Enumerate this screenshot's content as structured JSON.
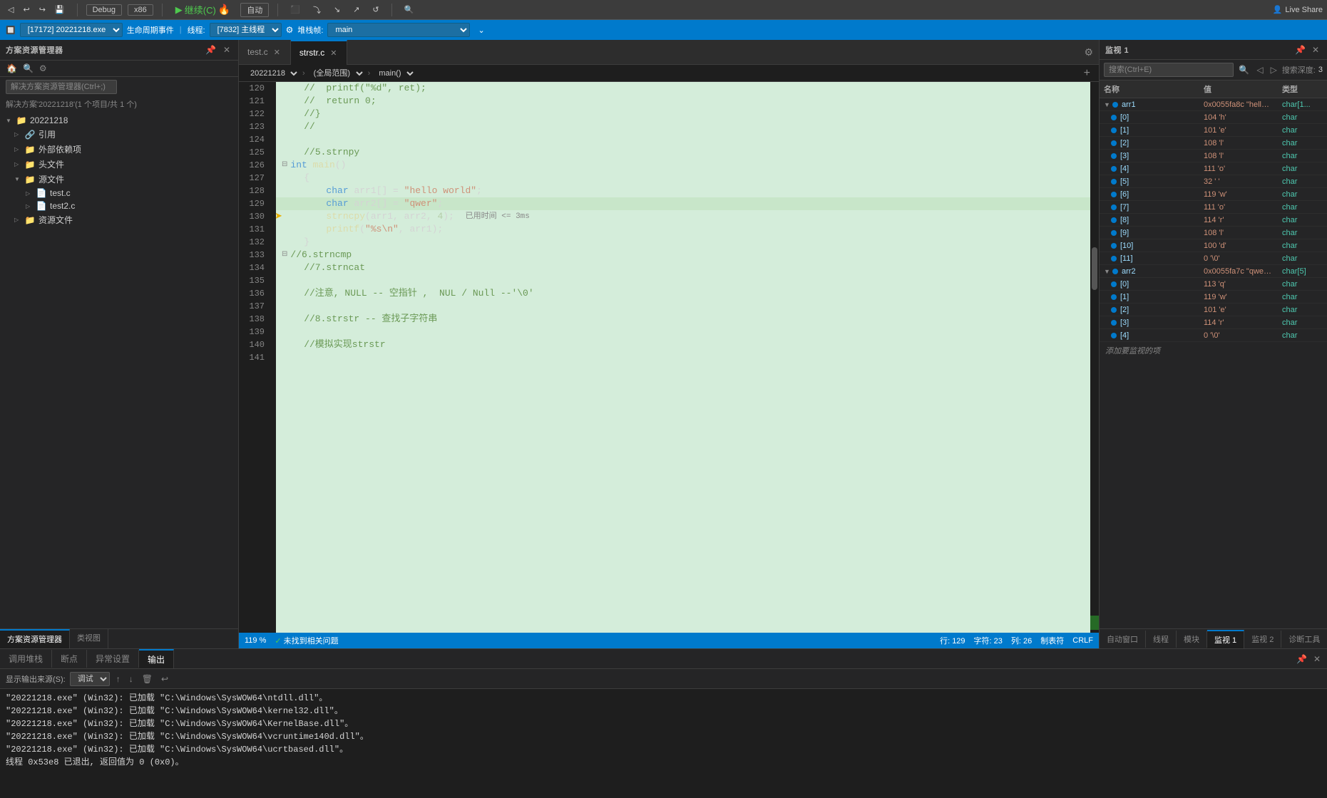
{
  "app": {
    "title": "Visual Studio Debug"
  },
  "top_toolbar": {
    "debug_mode": "Debug",
    "arch": "x86",
    "continue_label": "继续(C)",
    "auto_label": "自动",
    "live_share": "Live Share"
  },
  "debug_bar": {
    "process": "[17172] 20221218.exe",
    "event_label": "生命周期事件",
    "thread_label": "线程:",
    "thread": "[7832] 主线程",
    "stack_label": "堆栈帧:",
    "stack": "main"
  },
  "sidebar": {
    "title": "方案资源管理器",
    "search_placeholder": "解决方案资源管理器(Ctrl+;)",
    "solution_label": "解决方案'20221218'(1 个项目/共 1 个)",
    "items": [
      {
        "id": "solution",
        "label": "20221218",
        "indent": 0,
        "type": "folder",
        "expanded": true
      },
      {
        "id": "ref",
        "label": "引用",
        "indent": 1,
        "type": "ref"
      },
      {
        "id": "external",
        "label": "外部依赖项",
        "indent": 1,
        "type": "folder"
      },
      {
        "id": "header",
        "label": "头文件",
        "indent": 1,
        "type": "folder"
      },
      {
        "id": "source",
        "label": "源文件",
        "indent": 1,
        "type": "folder",
        "expanded": true
      },
      {
        "id": "test_c",
        "label": "test.c",
        "indent": 2,
        "type": "file"
      },
      {
        "id": "test2_c",
        "label": "test2.c",
        "indent": 2,
        "type": "file"
      },
      {
        "id": "resource",
        "label": "资源文件",
        "indent": 1,
        "type": "folder"
      }
    ],
    "bottom_tabs": [
      {
        "id": "solution-explorer",
        "label": "方案资源管理器"
      },
      {
        "id": "class-view",
        "label": "类视图"
      }
    ]
  },
  "editor": {
    "tabs": [
      {
        "id": "test-c",
        "label": "test.c",
        "active": false,
        "modified": false
      },
      {
        "id": "strstr-c",
        "label": "strstr.c",
        "active": true,
        "modified": false
      }
    ],
    "breadcrumb": {
      "file": "20221218",
      "scope": "(全局范围)",
      "function": "main()"
    },
    "lines": [
      {
        "num": 120,
        "code": "    //  printf(\"%d\", ret);",
        "type": "comment"
      },
      {
        "num": 121,
        "code": "    //  return 0;",
        "type": "comment"
      },
      {
        "num": 122,
        "code": "    //}",
        "type": "comment"
      },
      {
        "num": 123,
        "code": "    //",
        "type": "comment"
      },
      {
        "num": 124,
        "code": ""
      },
      {
        "num": 125,
        "code": "    //5.strnpy",
        "type": "comment"
      },
      {
        "num": 126,
        "code": "int main()",
        "type": "code"
      },
      {
        "num": 127,
        "code": "    {",
        "type": "code"
      },
      {
        "num": 128,
        "code": "        char arr1[] = \"hello world\";",
        "type": "code"
      },
      {
        "num": 129,
        "code": "        char arr2[] = \"qwer\";",
        "type": "code",
        "current": true
      },
      {
        "num": 130,
        "code": "        strncpy(arr1, arr2, 4);",
        "type": "code",
        "hint": "已用时间 <= 3ms"
      },
      {
        "num": 131,
        "code": "        printf(\"%s\\n\", arr1);",
        "type": "code"
      },
      {
        "num": 132,
        "code": "    }",
        "type": "code"
      },
      {
        "num": 133,
        "code": "    //6.strncmp",
        "type": "comment"
      },
      {
        "num": 134,
        "code": "    //7.strncat",
        "type": "comment"
      },
      {
        "num": 135,
        "code": ""
      },
      {
        "num": 136,
        "code": "    //注意, NULL -- 空指针 ,  NUL / Null --'\\0'",
        "type": "comment"
      },
      {
        "num": 137,
        "code": ""
      },
      {
        "num": 138,
        "code": "    //8.strstr -- 查找子字符串",
        "type": "comment"
      },
      {
        "num": 139,
        "code": ""
      },
      {
        "num": 140,
        "code": "    //模拟实现strstr",
        "type": "comment"
      },
      {
        "num": 141,
        "code": ""
      }
    ],
    "status": {
      "zoom": "119 %",
      "status_ok": "✓",
      "status_text": "未找到相关问题",
      "line": "行: 129",
      "char": "字符: 23",
      "col": "列: 26",
      "tab": "制表符",
      "encoding": "CRLF"
    }
  },
  "watch": {
    "title": "监视 1",
    "search_placeholder": "搜索(Ctrl+E)",
    "search_depth_label": "搜索深度:",
    "search_depth": "3",
    "columns": [
      "名称",
      "值",
      "类型"
    ],
    "items": [
      {
        "id": "arr1",
        "name": "arr1",
        "value": "0x0055fa8c \"hello ...\"",
        "type": "char[1...",
        "expanded": true,
        "has_loop": true,
        "children": [
          {
            "id": "arr1_0",
            "name": "[0]",
            "value": "104 'h'",
            "type": "char"
          },
          {
            "id": "arr1_1",
            "name": "[1]",
            "value": "101 'e'",
            "type": "char"
          },
          {
            "id": "arr1_2",
            "name": "[2]",
            "value": "108 'l'",
            "type": "char"
          },
          {
            "id": "arr1_3",
            "name": "[3]",
            "value": "108 'l'",
            "type": "char"
          },
          {
            "id": "arr1_4",
            "name": "[4]",
            "value": "111 'o'",
            "type": "char"
          },
          {
            "id": "arr1_5",
            "name": "[5]",
            "value": "32 ' '",
            "type": "char"
          },
          {
            "id": "arr1_6",
            "name": "[6]",
            "value": "119 'w'",
            "type": "char"
          },
          {
            "id": "arr1_7",
            "name": "[7]",
            "value": "111 'o'",
            "type": "char"
          },
          {
            "id": "arr1_8",
            "name": "[8]",
            "value": "114 'r'",
            "type": "char"
          },
          {
            "id": "arr1_9",
            "name": "[9]",
            "value": "108 'l'",
            "type": "char"
          },
          {
            "id": "arr1_10",
            "name": "[10]",
            "value": "100 'd'",
            "type": "char"
          },
          {
            "id": "arr1_11",
            "name": "[11]",
            "value": "0 '\\0'",
            "type": "char"
          }
        ]
      },
      {
        "id": "arr2",
        "name": "arr2",
        "value": "0x0055fa7c \"qwer\"",
        "type": "char[5]",
        "expanded": true,
        "has_loop": true,
        "children": [
          {
            "id": "arr2_0",
            "name": "[0]",
            "value": "113 'q'",
            "type": "char"
          },
          {
            "id": "arr2_1",
            "name": "[1]",
            "value": "119 'w'",
            "type": "char"
          },
          {
            "id": "arr2_2",
            "name": "[2]",
            "value": "101 'e'",
            "type": "char"
          },
          {
            "id": "arr2_3",
            "name": "[3]",
            "value": "114 'r'",
            "type": "char"
          },
          {
            "id": "arr2_4",
            "name": "[4]",
            "value": "0 '\\0'",
            "type": "char"
          }
        ]
      }
    ],
    "add_placeholder": "添加要监视的项",
    "bottom_tabs": [
      {
        "id": "auto",
        "label": "自动窗口"
      },
      {
        "id": "thread",
        "label": "线程"
      },
      {
        "id": "module",
        "label": "模块"
      },
      {
        "id": "watch1",
        "label": "监视 1",
        "active": true
      },
      {
        "id": "watch2",
        "label": "监视 2"
      },
      {
        "id": "diag",
        "label": "诊断工具"
      }
    ]
  },
  "output": {
    "title": "输出",
    "source_label": "显示输出来源(S):",
    "source": "调试",
    "lines": [
      "\"20221218.exe\" (Win32): 已加载 \"C:\\Windows\\SysWOW64\\ntdll.dll\"。",
      "\"20221218.exe\" (Win32): 已加载 \"C:\\Windows\\SysWOW64\\kernel32.dll\"。",
      "\"20221218.exe\" (Win32): 已加载 \"C:\\Windows\\SysWOW64\\KernelBase.dll\"。",
      "\"20221218.exe\" (Win32): 已加载 \"C:\\Windows\\SysWOW64\\vcruntime140d.dll\"。",
      "\"20221218.exe\" (Win32): 已加载 \"C:\\Windows\\SysWOW64\\ucrtbased.dll\"。",
      "线程 0x53e8 已退出, 返回值为 0 (0x0)。"
    ],
    "bottom_tabs": [
      {
        "id": "callstack",
        "label": "调用堆栈"
      },
      {
        "id": "breakpoints",
        "label": "断点"
      },
      {
        "id": "exceptions",
        "label": "异常设置"
      },
      {
        "id": "output",
        "label": "输出",
        "active": true
      }
    ]
  }
}
